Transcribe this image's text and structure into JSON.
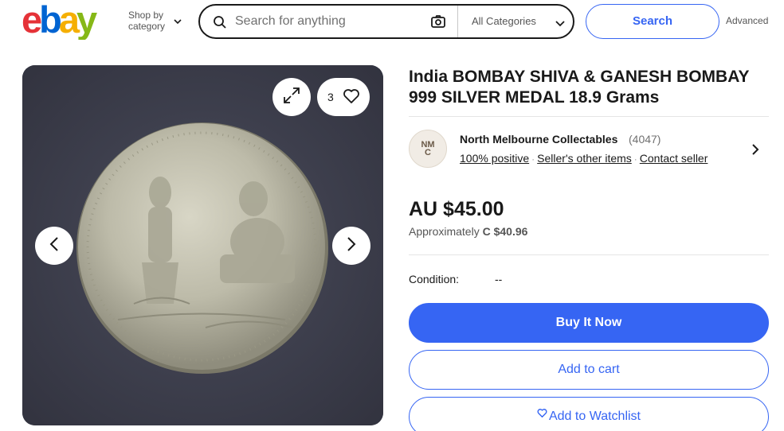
{
  "header": {
    "shop_by_line1": "Shop by",
    "shop_by_line2": "category",
    "search_placeholder": "Search for anything",
    "category_select": "All Categories",
    "search_button": "Search",
    "advanced_link": "Advanced"
  },
  "gallery": {
    "watch_count": "3"
  },
  "listing": {
    "title": "India BOMBAY SHIVA & GANESH BOMBAY 999 SILVER MEDAL 18.9 Grams",
    "seller": {
      "avatar_initials_top": "NM",
      "avatar_initials_bottom": "C",
      "name": "North Melbourne Collectables",
      "feedback_count": "(4047)",
      "positive": "100% positive",
      "other_items": "Seller's other items",
      "contact": "Contact seller"
    },
    "price": "AU $45.00",
    "approx_label": "Approximately",
    "approx_value": "C $40.96",
    "condition_label": "Condition:",
    "condition_value": "--",
    "buy_now": "Buy It Now",
    "add_to_cart": "Add to cart",
    "add_to_watchlist": "Add to Watchlist"
  },
  "colors": {
    "accent": "#3665f3",
    "text": "#191919",
    "muted": "#707070"
  }
}
